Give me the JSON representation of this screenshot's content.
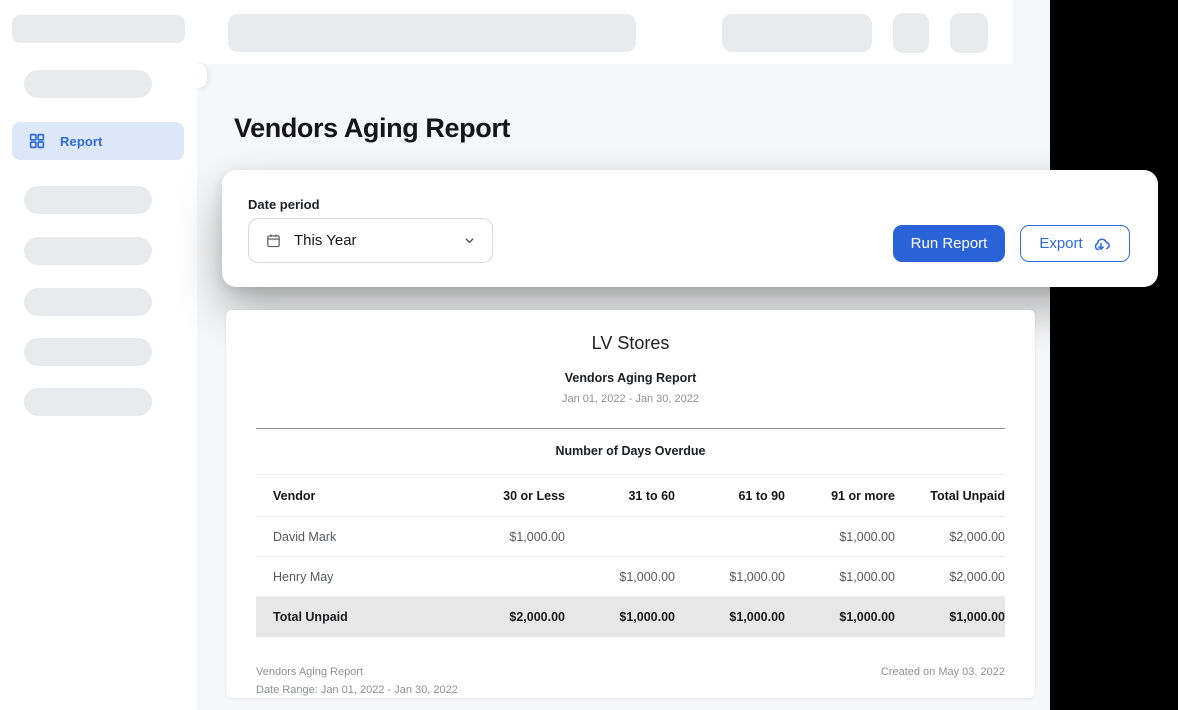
{
  "colors": {
    "accent": "#2a63d8",
    "accent_link": "#2f6bdb",
    "active_nav_bg": "#dce8f9",
    "total_row_bg": "#e7e7e8",
    "canvas_outside": "#000000",
    "app_background": "#f6f7f8"
  },
  "sidebar": {
    "active_item": {
      "label": "Report",
      "icon": "grid-icon"
    }
  },
  "page": {
    "title": "Vendors Aging Report"
  },
  "filters": {
    "date_period_label": "Date period",
    "date_period_value": "This Year",
    "date_period_icon": "calendar-icon",
    "run_report_label": "Run Report",
    "export_label": "Export",
    "export_icon": "cloud-download-icon"
  },
  "report": {
    "company": "LV Stores",
    "title": "Vendors Aging Report",
    "date_range": "Jan 01, 2022 - Jan 30, 2022",
    "table": {
      "group_header": "Number of Days Overdue",
      "columns": [
        "Vendor",
        "30 or Less",
        "31 to 60",
        "61 to 90",
        "91 or more",
        "Total Unpaid"
      ],
      "rows": [
        {
          "vendor": "David Mark",
          "values": [
            "$1,000.00",
            "",
            "",
            "$1,000.00",
            "$2,000.00"
          ]
        },
        {
          "vendor": "Henry May",
          "values": [
            "",
            "$1,000.00",
            "$1,000.00",
            "$1,000.00",
            "$2,000.00"
          ]
        }
      ],
      "total_row": {
        "label": "Total Unpaid",
        "values": [
          "$2,000.00",
          "$1,000.00",
          "$1,000.00",
          "$1,000.00",
          "$1,000.00"
        ]
      }
    },
    "footer": {
      "left_line1": "Vendors Aging Report",
      "left_line2": "Date Range: Jan 01, 2022 - Jan 30, 2022",
      "right": "Created on May 03, 2022"
    }
  }
}
